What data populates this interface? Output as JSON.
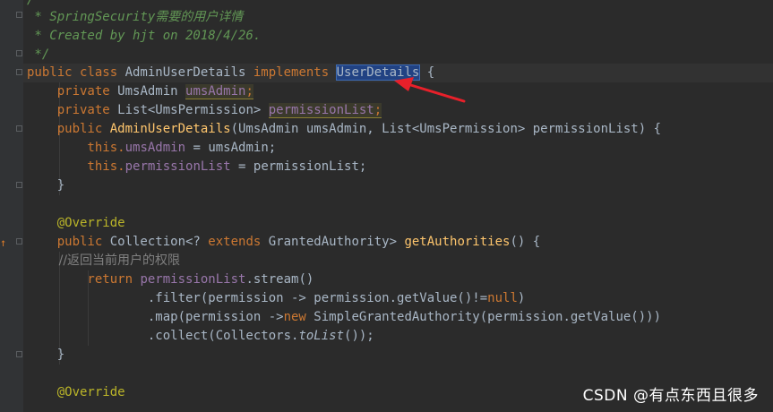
{
  "editor": {
    "lines": {
      "l1": "/**",
      "l2a": " * SpringSecurity",
      "l2b": "需要的用户详情",
      "l3": " * Created by hjt on 2018/4/26.",
      "l4": " */",
      "l5": {
        "kw1": "public class ",
        "name": "AdminUserDetails ",
        "kw2": "implements ",
        "iface": "UserDetails",
        "tail": " {"
      },
      "l6": {
        "kw": "    private ",
        "type": "UmsAdmin ",
        "field": "umsAdmin",
        "semi": ";"
      },
      "l7": {
        "kw": "    private ",
        "type": "List<UmsPermission> ",
        "field": "permissionList",
        "semi": ";"
      },
      "l8": {
        "kw": "    public ",
        "method": "AdminUserDetails",
        "rest": "(UmsAdmin umsAdmin, List<UmsPermission> permissionList) {"
      },
      "l9": {
        "kw": "        this",
        "dot": ".",
        "field": "umsAdmin",
        "rest": " = umsAdmin;"
      },
      "l10": {
        "kw": "        this",
        "dot": ".",
        "field": "permissionList",
        "rest": " = permissionList;"
      },
      "l11": "    }",
      "l12": "",
      "l13": "    @Override",
      "l14": {
        "kw": "    public ",
        "t1": "Collection<? ",
        "kw2": "extends ",
        "t2": "GrantedAuthority> ",
        "method": "getAuthorities",
        "rest": "() {"
      },
      "l15": "        //返回当前用户的权限",
      "l16": {
        "kw": "        return ",
        "field": "permissionList",
        "rest": ".stream()"
      },
      "l17": {
        "pre": "                .filter(permission -> permission.getValue()!=",
        "kw": "null",
        "post": ")"
      },
      "l18": {
        "pre": "                .map(permission ->",
        "kw": "new ",
        "post": "SimpleGrantedAuthority(permission.getValue()))"
      },
      "l19": {
        "pre": "                .collect(Collectors.",
        "ital": "toList",
        "post": "());"
      },
      "l20": "    }",
      "l21": "",
      "l22": "    @Override"
    }
  },
  "watermark": "CSDN @有点东西且很多",
  "colors": {
    "background": "#2b2b2b",
    "keyword": "#cc7832",
    "field": "#9876aa",
    "method": "#ffc66d",
    "comment": "#629755",
    "annotation": "#bbb529",
    "selection": "#214283",
    "arrow": "#e8202a"
  }
}
